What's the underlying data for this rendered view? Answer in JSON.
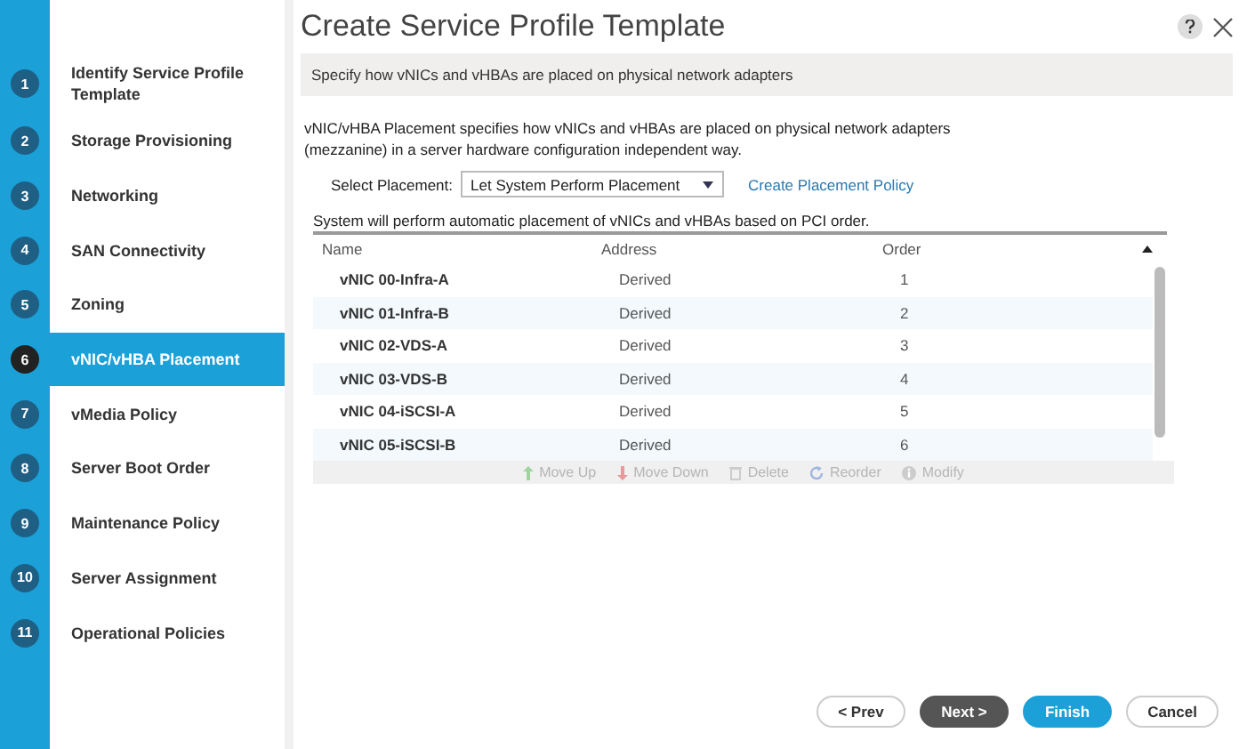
{
  "wizard": {
    "title": "Create Service Profile Template"
  },
  "steps": [
    {
      "number": "1",
      "label": "Identify Service Profile Template",
      "selected": false
    },
    {
      "number": "2",
      "label": "Storage Provisioning",
      "selected": false
    },
    {
      "number": "3",
      "label": "Networking",
      "selected": false
    },
    {
      "number": "4",
      "label": "SAN Connectivity",
      "selected": false
    },
    {
      "number": "5",
      "label": "Zoning",
      "selected": false
    },
    {
      "number": "6",
      "label": "vNIC/vHBA Placement",
      "selected": true
    },
    {
      "number": "7",
      "label": "vMedia Policy",
      "selected": false
    },
    {
      "number": "8",
      "label": "Server Boot Order",
      "selected": false
    },
    {
      "number": "9",
      "label": "Maintenance Policy",
      "selected": false
    },
    {
      "number": "10",
      "label": "Server Assignment",
      "selected": false
    },
    {
      "number": "11",
      "label": "Operational Policies",
      "selected": false
    }
  ],
  "banner": "Specify how vNICs and vHBAs are placed on physical network adapters",
  "description": "vNIC/vHBA Placement specifies how vNICs and vHBAs are placed on physical network adapters (mezzanine) in a server hardware configuration independent way.",
  "placement": {
    "label": "Select Placement:",
    "value": "Let System Perform Placement",
    "link": "Create Placement Policy"
  },
  "table": {
    "caption": "System will perform automatic placement of vNICs and vHBAs based on PCI order.",
    "columns": [
      "Name",
      "Address",
      "Order"
    ],
    "rows": [
      [
        "vNIC 00-Infra-A",
        "Derived",
        "1"
      ],
      [
        "vNIC 01-Infra-B",
        "Derived",
        "2"
      ],
      [
        "vNIC 02-VDS-A",
        "Derived",
        "3"
      ],
      [
        "vNIC 03-VDS-B",
        "Derived",
        "4"
      ],
      [
        "vNIC 04-iSCSI-A",
        "Derived",
        "5"
      ],
      [
        "vNIC 05-iSCSI-B",
        "Derived",
        "6"
      ]
    ]
  },
  "toolbar": [
    {
      "kind": "up",
      "label": "Move Up",
      "disabled": true
    },
    {
      "kind": "down",
      "label": "Move Down",
      "disabled": true
    },
    {
      "kind": "delete",
      "label": "Delete",
      "disabled": true
    },
    {
      "kind": "reorder",
      "label": "Reorder",
      "disabled": true
    },
    {
      "kind": "modify",
      "label": "Modify",
      "disabled": true
    }
  ],
  "buttons": [
    {
      "kind": "prev",
      "label": "< Prev"
    },
    {
      "kind": "next",
      "label": "Next >"
    },
    {
      "kind": "finish",
      "label": "Finish"
    },
    {
      "kind": "cancel",
      "label": "Cancel"
    }
  ]
}
